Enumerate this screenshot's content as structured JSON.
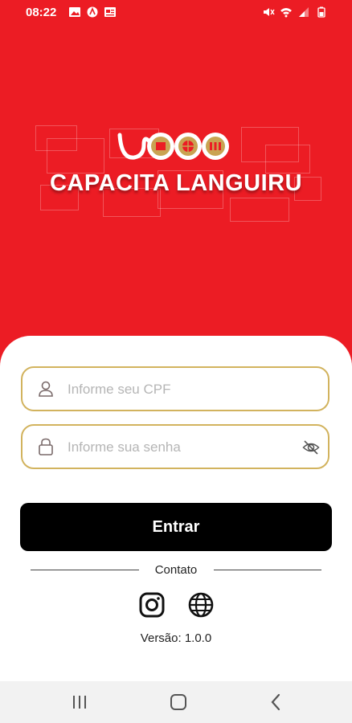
{
  "status_bar": {
    "time": "08:22"
  },
  "brand": {
    "title": "CAPACITA LANGUIRU"
  },
  "form": {
    "cpf_placeholder": "Informe seu CPF",
    "password_placeholder": "Informe sua senha",
    "submit_label": "Entrar"
  },
  "contact": {
    "label": "Contato",
    "icons": [
      "instagram-icon",
      "globe-icon"
    ]
  },
  "version": "Versão: 1.0.0",
  "colors": {
    "brand_red": "#ec1c24",
    "field_border": "#d2b35e",
    "button": "#000000",
    "logo_gold": "#c9a352"
  }
}
